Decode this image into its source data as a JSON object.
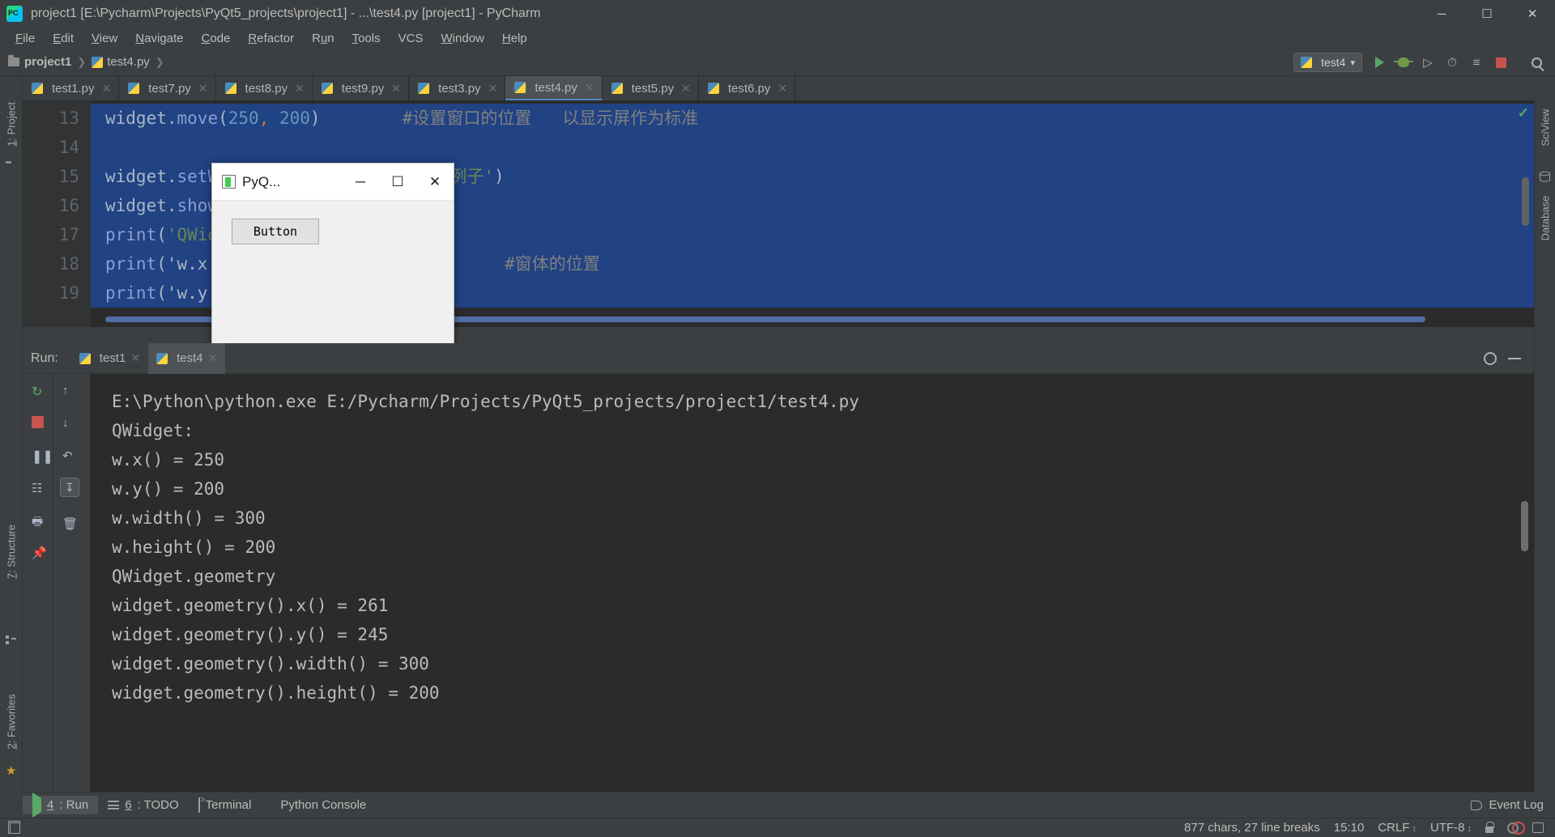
{
  "window": {
    "title": "project1 [E:\\Pycharm\\Projects\\PyQt5_projects\\project1] - ...\\test4.py [project1] - PyCharm",
    "app_icon": "pycharm-logo-icon",
    "minimize": "─",
    "maximize": "☐",
    "close": "✕"
  },
  "menubar": {
    "items": [
      {
        "pre": "",
        "mn": "F",
        "post": "ile"
      },
      {
        "pre": "",
        "mn": "E",
        "post": "dit"
      },
      {
        "pre": "",
        "mn": "V",
        "post": "iew"
      },
      {
        "pre": "",
        "mn": "N",
        "post": "avigate"
      },
      {
        "pre": "",
        "mn": "C",
        "post": "ode"
      },
      {
        "pre": "",
        "mn": "R",
        "post": "efactor"
      },
      {
        "pre": "R",
        "mn": "u",
        "post": "n"
      },
      {
        "pre": "",
        "mn": "T",
        "post": "ools"
      },
      {
        "pre": "VCS",
        "mn": "",
        "post": ""
      },
      {
        "pre": "",
        "mn": "W",
        "post": "indow"
      },
      {
        "pre": "",
        "mn": "H",
        "post": "elp"
      }
    ]
  },
  "navbar": {
    "breadcrumb": [
      {
        "label": "project1",
        "icon": "folder-icon"
      },
      {
        "label": "test4.py",
        "icon": "python-file-icon"
      }
    ],
    "separator": "❯",
    "run_config": {
      "label": "test4",
      "icon": "python-run-config-icon",
      "chevron": "▾"
    },
    "toolbar_icons": [
      "run-icon",
      "debug-icon",
      "run-with-coverage-icon",
      "profile-icon",
      "run-dashboard-icon",
      "stop-icon",
      "search-everywhere-icon"
    ]
  },
  "editor_tabs": [
    {
      "label": "test1.py",
      "active": false
    },
    {
      "label": "test7.py",
      "active": false
    },
    {
      "label": "test8.py",
      "active": false
    },
    {
      "label": "test9.py",
      "active": false
    },
    {
      "label": "test3.py",
      "active": false
    },
    {
      "label": "test4.py",
      "active": true
    },
    {
      "label": "test5.py",
      "active": false
    },
    {
      "label": "test6.py",
      "active": false
    }
  ],
  "tab_close_glyph": "✕",
  "left_strip": {
    "project_label": {
      "mn": "1",
      "text": ": Project"
    },
    "structure_label": {
      "mn": "7",
      "text": ": Structure"
    },
    "favorites_label": {
      "mn": "2",
      "text": ": Favorites"
    }
  },
  "right_strip": {
    "sciview_label": "SciView",
    "database_label": "Database"
  },
  "editor": {
    "line_numbers": [
      "13",
      "14",
      "15",
      "16",
      "17",
      "18",
      "19"
    ],
    "lines": [
      {
        "n": "13",
        "selected": true,
        "tokens": [
          {
            "t": "widget",
            "c": "tok-plain"
          },
          {
            "t": ".",
            "c": "tok-punct"
          },
          {
            "t": "move",
            "c": "tok-fn"
          },
          {
            "t": "(",
            "c": "tok-punct"
          },
          {
            "t": "250",
            "c": "tok-num"
          },
          {
            "t": ",",
            "c": "tok-comma"
          },
          {
            "t": " 200",
            "c": "tok-num"
          },
          {
            "t": ")",
            "c": "tok-punct"
          },
          {
            "t": "        ",
            "c": "tok-plain"
          },
          {
            "t": "#设置窗口的位置   以显示屏作为标准",
            "c": "tok-com"
          }
        ]
      },
      {
        "n": "14",
        "selected": true,
        "tokens": []
      },
      {
        "n": "15",
        "selected": true,
        "tokens": [
          {
            "t": "widget",
            "c": "tok-plain"
          },
          {
            "t": ".",
            "c": "tok-punct"
          },
          {
            "t": "setWindowTitle",
            "c": "tok-fn"
          },
          {
            "t": "(",
            "c": "tok-punct"
          },
          {
            "t": "'PyQt坐标系统例子'",
            "c": "tok-str"
          },
          {
            "t": ")",
            "c": "tok-punct"
          }
        ]
      },
      {
        "n": "16",
        "selected": true,
        "tokens": [
          {
            "t": "widget",
            "c": "tok-plain"
          },
          {
            "t": ".",
            "c": "tok-punct"
          },
          {
            "t": "show()",
            "c": "tok-fn"
          }
        ]
      },
      {
        "n": "17",
        "selected": true,
        "tokens": [
          {
            "t": "print",
            "c": "tok-fn"
          },
          {
            "t": "(",
            "c": "tok-punct"
          },
          {
            "t": "'QWidget:'",
            "c": "tok-str"
          },
          {
            "t": ")",
            "c": "tok-punct"
          }
        ]
      },
      {
        "n": "18",
        "selected": true,
        "tokens": [
          {
            "t": "print",
            "c": "tok-fn"
          },
          {
            "t": "(",
            "c": "tok-punct"
          },
          {
            "t": "'w.x() = %d' % widget.x()",
            "c": "tok-plain"
          },
          {
            "t": ")",
            "c": "tok-punct"
          },
          {
            "t": "       ",
            "c": "tok-plain"
          },
          {
            "t": "#窗体的位置",
            "c": "tok-com"
          }
        ]
      },
      {
        "n": "19",
        "selected": true,
        "tokens": [
          {
            "t": "print",
            "c": "tok-fn"
          },
          {
            "t": "(",
            "c": "tok-punct"
          },
          {
            "t": "'w.y() = %d' % widget.y()",
            "c": "tok-plain"
          },
          {
            "t": ")",
            "c": "tok-punct"
          }
        ]
      }
    ],
    "inspection_ok": "✓"
  },
  "pyqt_window": {
    "title": "PyQ...",
    "icon": "pyqt-app-icon",
    "minimize": "─",
    "maximize": "☐",
    "close": "✕",
    "button_label": "Button"
  },
  "run_tool": {
    "label": "Run:",
    "tabs": [
      {
        "label": "test1",
        "active": false
      },
      {
        "label": "test4",
        "active": true
      }
    ],
    "close_glyph": "✕",
    "settings_icon": "gear-icon",
    "hide_icon": "minimize-icon",
    "side_icons": [
      "rerun-icon",
      "stop-icon",
      "pause-icon",
      "dump-threads-icon",
      "print-icon",
      "pin-icon",
      "trash-icon",
      "up-arrow-icon",
      "down-arrow-icon",
      "wrap-icon",
      "scroll-to-end-icon"
    ],
    "output": [
      "E:\\Python\\python.exe E:/Pycharm/Projects/PyQt5_projects/project1/test4.py",
      "QWidget:",
      "w.x() = 250",
      "w.y() = 200",
      "w.width() = 300",
      "w.height() = 200",
      "QWidget.geometry",
      "widget.geometry().x() = 261",
      "widget.geometry().y() = 245",
      "widget.geometry().width() = 300",
      "widget.geometry().height() = 200"
    ]
  },
  "bottom_bar": {
    "buttons": [
      {
        "icon": "run-icon",
        "mn": "4",
        "text": ": Run",
        "active": true
      },
      {
        "icon": "todo-icon",
        "mn": "6",
        "text": ": TODO",
        "active": false
      },
      {
        "icon": "terminal-icon",
        "mn": "",
        "text": "Terminal",
        "active": false
      },
      {
        "icon": "python-console-icon",
        "mn": "",
        "text": "Python Console",
        "active": false
      }
    ],
    "event_log": {
      "label": "Event Log",
      "icon": "event-log-icon"
    }
  },
  "status_bar": {
    "left_icon": "toggle-toolwindows-icon",
    "chars_info": "877 chars, 27 line breaks",
    "caret_position": "15:10",
    "line_separator": "CRLF",
    "encoding": "UTF-8",
    "updown_glyph": "↕",
    "icons": [
      "lock-icon",
      "inspection-gear-icon",
      "database-icon"
    ]
  }
}
